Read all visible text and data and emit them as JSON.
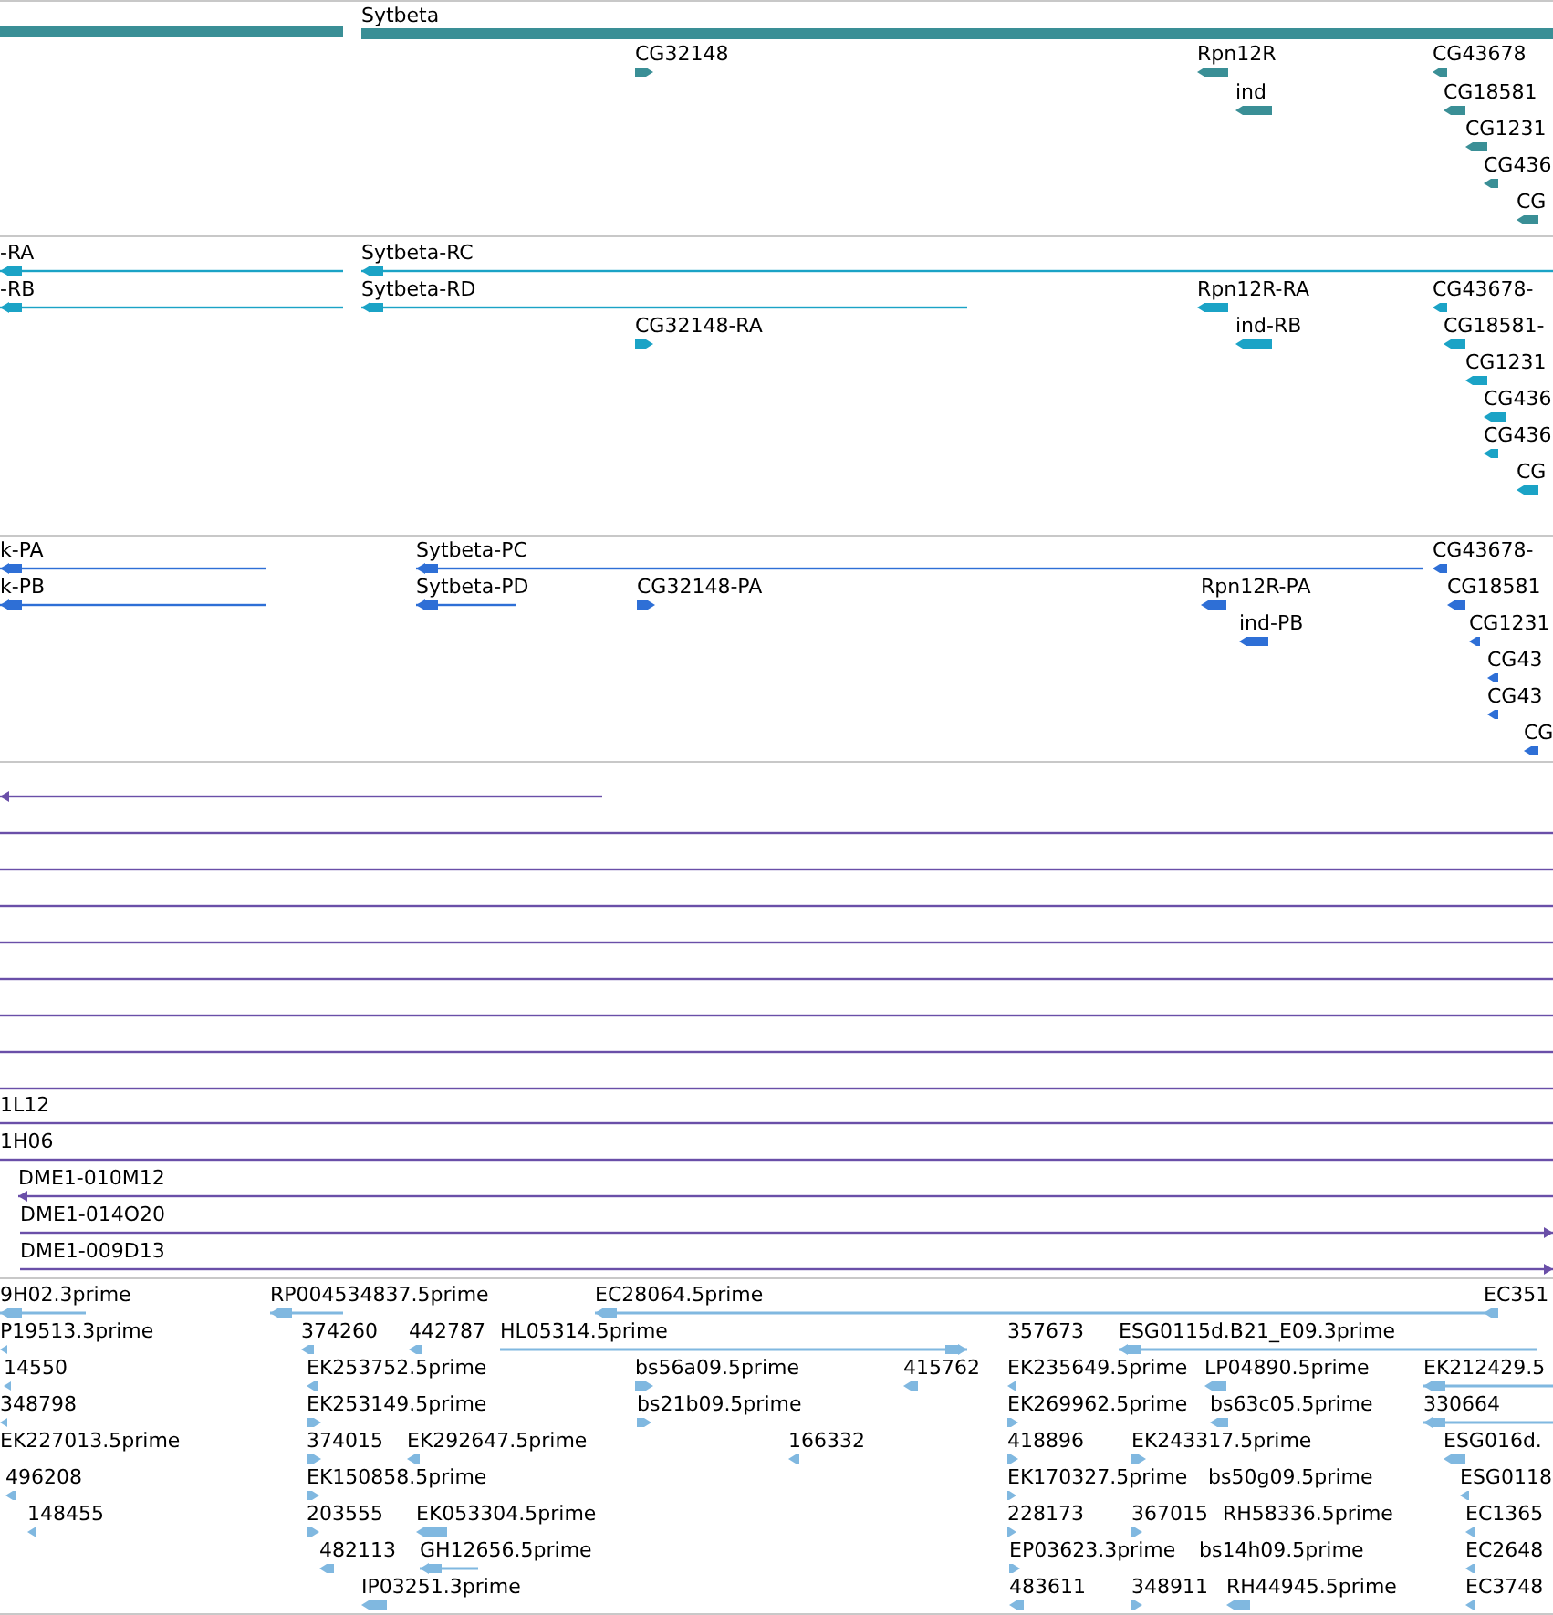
{
  "tracks": [
    {
      "kind": "gene",
      "color": "#3a8f96",
      "features": [
        {
          "kind": "reverse"
        },
        {
          "label": "Sytbeta",
          "kind": "reverse"
        },
        {
          "label": "CG32148",
          "kind": "forward"
        },
        {
          "label": "Rpn12R",
          "kind": "reverse"
        },
        {
          "label": "ind",
          "kind": "reverse"
        },
        {
          "label": "CG43678",
          "kind": "reverse"
        },
        {
          "label": "CG18581",
          "kind": "reverse"
        },
        {
          "label": "CG1231",
          "kind": "reverse"
        },
        {
          "label": "CG436",
          "kind": "reverse"
        },
        {
          "label": "CG",
          "kind": "reverse"
        }
      ]
    },
    {
      "kind": "transcript",
      "color": "#1ba3c6",
      "features": [
        {
          "label": "-RA",
          "kind": "reverse"
        },
        {
          "label": "Sytbeta-RC",
          "kind": "reverse"
        },
        {
          "label": "-RB",
          "kind": "reverse"
        },
        {
          "label": "Sytbeta-RD",
          "kind": "reverse"
        },
        {
          "label": "Rpn12R-RA",
          "kind": "reverse"
        },
        {
          "label": "CG43678-",
          "kind": "reverse"
        },
        {
          "label": "CG32148-RA",
          "kind": "forward"
        },
        {
          "label": "ind-RB",
          "kind": "reverse"
        },
        {
          "label": "CG18581-",
          "kind": "reverse"
        },
        {
          "label": "CG1231",
          "kind": "reverse"
        },
        {
          "label": "CG436",
          "kind": "reverse"
        },
        {
          "label": "CG436",
          "kind": "reverse"
        },
        {
          "label": "CG",
          "kind": "reverse"
        }
      ]
    },
    {
      "kind": "protein",
      "color": "#2e6fd6",
      "features": [
        {
          "label": "k-PA",
          "kind": "reverse"
        },
        {
          "label": "Sytbeta-PC",
          "kind": "reverse"
        },
        {
          "label": "CG43678-",
          "kind": "reverse"
        },
        {
          "label": "k-PB",
          "kind": "reverse"
        },
        {
          "label": "Sytbeta-PD",
          "kind": "reverse"
        },
        {
          "label": "CG32148-PA",
          "kind": "forward"
        },
        {
          "label": "Rpn12R-PA",
          "kind": "reverse"
        },
        {
          "label": "CG18581",
          "kind": "reverse"
        },
        {
          "label": "ind-PB",
          "kind": "reverse"
        },
        {
          "label": "CG1231",
          "kind": "reverse"
        },
        {
          "label": "CG43",
          "kind": "reverse"
        },
        {
          "label": "CG43",
          "kind": "reverse"
        },
        {
          "label": "CG",
          "kind": "reverse"
        }
      ]
    },
    {
      "kind": "clone",
      "color": "#6a4fa8",
      "features": [
        {
          "kind": "reverse"
        },
        {
          "kind": "line"
        },
        {
          "kind": "line"
        },
        {
          "kind": "line"
        },
        {
          "kind": "line"
        },
        {
          "kind": "line"
        },
        {
          "kind": "line"
        },
        {
          "kind": "line"
        },
        {
          "kind": "line"
        },
        {
          "label": "1L12",
          "kind": "line"
        },
        {
          "label": "1H06",
          "kind": "line"
        },
        {
          "label": "DME1-010M12",
          "kind": "reverse"
        },
        {
          "label": "DME1-014O20",
          "kind": "forward"
        },
        {
          "label": "DME1-009D13",
          "kind": "forward"
        }
      ]
    },
    {
      "kind": "est",
      "color": "#80b8e0",
      "features": [
        {
          "label": "9H02.3prime",
          "kind": "reverse"
        },
        {
          "label": "RP004534837.5prime",
          "kind": "reverse"
        },
        {
          "label": "EC28064.5prime",
          "kind": "reverse"
        },
        {
          "label": "EC351",
          "kind": "reverse"
        },
        {
          "label": "P19513.3prime",
          "kind": "reverse"
        },
        {
          "label": "374260",
          "kind": "reverse"
        },
        {
          "label": "442787",
          "kind": "reverse"
        },
        {
          "label": "HL05314.5prime",
          "kind": "forward"
        },
        {
          "label": "357673"
        },
        {
          "label": "ESG0115d.B21_E09.3prime",
          "kind": "reverse"
        },
        {
          "label": "14550",
          "kind": "reverse"
        },
        {
          "label": "EK253752.5prime",
          "kind": "reverse"
        },
        {
          "label": "bs56a09.5prime",
          "kind": "forward"
        },
        {
          "label": "415762",
          "kind": "reverse"
        },
        {
          "label": "EK235649.5prime",
          "kind": "reverse"
        },
        {
          "label": "LP04890.5prime",
          "kind": "reverse"
        },
        {
          "label": "EK212429.5",
          "kind": "reverse"
        },
        {
          "label": "348798",
          "kind": "reverse"
        },
        {
          "label": "EK253149.5prime",
          "kind": "forward"
        },
        {
          "label": "bs21b09.5prime",
          "kind": "forward"
        },
        {
          "label": "EK269962.5prime",
          "kind": "forward"
        },
        {
          "label": "bs63c05.5prime",
          "kind": "reverse"
        },
        {
          "label": "330664",
          "kind": "reverse"
        },
        {
          "label": "EK227013.5prime"
        },
        {
          "label": "374015",
          "kind": "forward"
        },
        {
          "label": "EK292647.5prime",
          "kind": "reverse"
        },
        {
          "label": "166332",
          "kind": "reverse"
        },
        {
          "label": "418896",
          "kind": "forward"
        },
        {
          "label": "EK243317.5prime",
          "kind": "forward"
        },
        {
          "label": "ESG016d.",
          "kind": "reverse"
        },
        {
          "label": "496208",
          "kind": "reverse"
        },
        {
          "label": "EK150858.5prime",
          "kind": "forward"
        },
        {
          "label": "EK170327.5prime",
          "kind": "forward"
        },
        {
          "label": "bs50g09.5prime"
        },
        {
          "label": "ESG0118",
          "kind": "reverse"
        },
        {
          "label": "148455",
          "kind": "reverse"
        },
        {
          "label": "203555",
          "kind": "forward"
        },
        {
          "label": "EK053304.5prime",
          "kind": "reverse"
        },
        {
          "label": "228173",
          "kind": "forward"
        },
        {
          "label": "367015",
          "kind": "forward"
        },
        {
          "label": "RH58336.5prime"
        },
        {
          "label": "EC1365",
          "kind": "reverse"
        },
        {
          "label": "482113",
          "kind": "reverse"
        },
        {
          "label": "GH12656.5prime",
          "kind": "reverse"
        },
        {
          "label": "EP03623.3prime",
          "kind": "forward"
        },
        {
          "label": "bs14h09.5prime"
        },
        {
          "label": "EC2648",
          "kind": "reverse"
        },
        {
          "label": "IP03251.3prime",
          "kind": "reverse"
        },
        {
          "label": "483611",
          "kind": "reverse"
        },
        {
          "label": "348911",
          "kind": "forward"
        },
        {
          "label": "RH44945.5prime",
          "kind": "reverse"
        },
        {
          "label": "EC3748",
          "kind": "reverse"
        }
      ]
    }
  ]
}
